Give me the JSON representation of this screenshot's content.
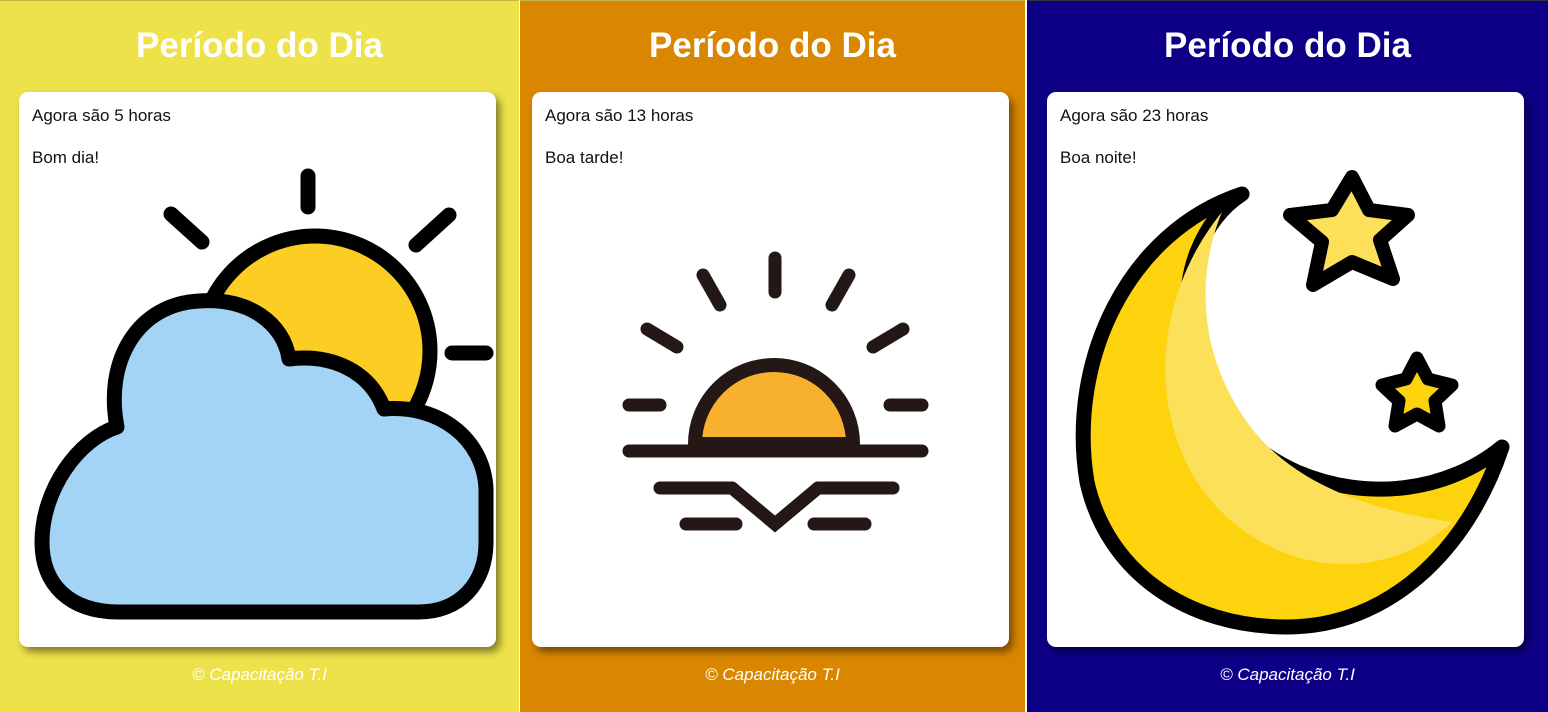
{
  "colors": {
    "morning_bg": "#ede24a",
    "afternoon_bg": "#d98700",
    "night_bg": "#0e0086",
    "card_bg": "#ffffff",
    "text": "#111111"
  },
  "panels": [
    {
      "title": "Período do Dia",
      "time_text": "Agora são 5 horas",
      "greeting": "Bom dia!",
      "icon": "sun-behind-cloud-icon",
      "footer": "© Capacitação T.I"
    },
    {
      "title": "Período do Dia",
      "time_text": "Agora são 13 horas",
      "greeting": "Boa tarde!",
      "icon": "sunset-icon",
      "footer": "© Capacitação T.I"
    },
    {
      "title": "Período do Dia",
      "time_text": "Agora são 23 horas",
      "greeting": "Boa noite!",
      "icon": "moon-and-stars-icon",
      "footer": "© Capacitação T.I"
    }
  ]
}
